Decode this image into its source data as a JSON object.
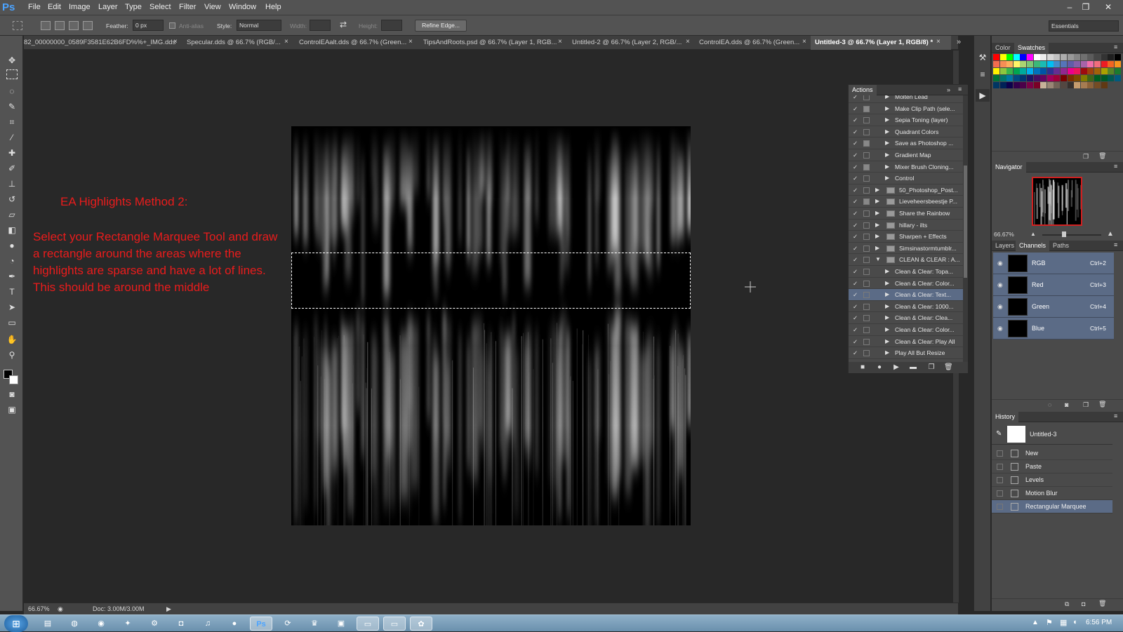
{
  "app": {
    "logo": "Ps"
  },
  "menu": [
    "File",
    "Edit",
    "Image",
    "Layer",
    "Type",
    "Select",
    "Filter",
    "View",
    "Window",
    "Help"
  ],
  "window_controls": {
    "minimize": "–",
    "restore": "❐",
    "close": "✕"
  },
  "options": {
    "feather_label": "Feather:",
    "feather_value": "0 px",
    "antialias_label": "Anti-alias",
    "style_label": "Style:",
    "style_value": "Normal",
    "width_label": "Width:",
    "height_label": "Height:",
    "refine_edge": "Refine Edge...",
    "workspace": "Essentials"
  },
  "tabs": [
    {
      "label": "82_00000000_0589F3581E62B6FD%%+_IMG.dds",
      "close": "×"
    },
    {
      "label": "Specular.dds @ 66.7% (RGB/...",
      "close": "×"
    },
    {
      "label": "ControlEAalt.dds @ 66.7% (Green...",
      "close": "×"
    },
    {
      "label": "TipsAndRoots.psd @ 66.7% (Layer 1, RGB...",
      "close": "×"
    },
    {
      "label": "Untitled-2 @ 66.7% (Layer 2, RGB/...",
      "close": "×"
    },
    {
      "label": "ControlEA.dds @ 66.7% (Green...",
      "close": "×"
    },
    {
      "label": "Untitled-3 @ 66.7% (Layer 1, RGB/8) *",
      "close": "×"
    }
  ],
  "tabs_overflow": "»",
  "annotation": {
    "title": "EA Highlights Method 2:",
    "body": "Select your Rectangle Marquee Tool and draw a rectangle around the areas where the highlights are sparse and have a lot of lines.  This should be around the middle"
  },
  "status": {
    "zoom": "66.67%",
    "doc": "Doc: 3.00M/3.00M",
    "arrow": "▶"
  },
  "actions_panel": {
    "title": "Actions",
    "items": [
      {
        "name": "Molten Lead",
        "level": 1,
        "box": false
      },
      {
        "name": "Make Clip Path (sele...",
        "level": 1,
        "box": true
      },
      {
        "name": "Sepia Toning (layer)",
        "level": 1,
        "box": false
      },
      {
        "name": "Quadrant Colors",
        "level": 1,
        "box": false
      },
      {
        "name": "Save as Photoshop ...",
        "level": 1,
        "box": true
      },
      {
        "name": "Gradient Map",
        "level": 1,
        "box": false
      },
      {
        "name": "Mixer Brush Cloning...",
        "level": 1,
        "box": true
      },
      {
        "name": "Control",
        "level": 1,
        "box": false
      },
      {
        "name": "50_Photoshop_Post...",
        "level": 0,
        "box": false
      },
      {
        "name": "Lieveheersbeestje P...",
        "level": 0,
        "box": true
      },
      {
        "name": "Share the Rainbow",
        "level": 0,
        "box": false
      },
      {
        "name": "hillary - ilts",
        "level": 0,
        "box": false
      },
      {
        "name": "Sharpen + Effects",
        "level": 0,
        "box": false
      },
      {
        "name": "Simsinastormtumblr...",
        "level": 0,
        "box": false
      },
      {
        "name": "CLEAN & CLEAR : A...",
        "level": 0,
        "box": false,
        "open": true
      },
      {
        "name": "Clean & Clear: Topa...",
        "level": 1,
        "box": false
      },
      {
        "name": "Clean & Clear: Color...",
        "level": 1,
        "box": false
      },
      {
        "name": "Clean & Clear: Text...",
        "level": 1,
        "box": false,
        "selected": true
      },
      {
        "name": "Clean & Clear: 1000...",
        "level": 1,
        "box": false
      },
      {
        "name": "Clean & Clear: Clea...",
        "level": 1,
        "box": false
      },
      {
        "name": "Clean & Clear: Color...",
        "level": 1,
        "box": false
      },
      {
        "name": "Clean & Clear: Play All",
        "level": 1,
        "box": false
      },
      {
        "name": "Play All But Resize",
        "level": 1,
        "box": false
      }
    ]
  },
  "color_panel": {
    "tabs": [
      "Color",
      "Swatches"
    ],
    "active": "Swatches"
  },
  "swatch_colors": [
    "#ff0000",
    "#ffff00",
    "#00ff00",
    "#00ffff",
    "#0000ff",
    "#ff00ff",
    "#ffffff",
    "#ebebeb",
    "#d6d6d6",
    "#c2c2c2",
    "#adadad",
    "#999999",
    "#858585",
    "#707070",
    "#5c5c5c",
    "#474747",
    "#333333",
    "#1f1f1f",
    "#000000",
    "#f26c4f",
    "#f68e55",
    "#fbaf5c",
    "#fff467",
    "#acd372",
    "#7cc576",
    "#3bb878",
    "#1abbb4",
    "#00bff3",
    "#438cca",
    "#5574b9",
    "#605ca8",
    "#855fa8",
    "#a763a8",
    "#f06ea9",
    "#f26d7d",
    "#ed1c24",
    "#f26522",
    "#f7941d",
    "#fff200",
    "#8dc63f",
    "#39b54a",
    "#00a651",
    "#00a99d",
    "#00aeef",
    "#0072bc",
    "#0054a6",
    "#2e3192",
    "#662d91",
    "#92278f",
    "#ec008c",
    "#ed145b",
    "#9e0b0f",
    "#a0410d",
    "#a36209",
    "#aba000",
    "#598527",
    "#1a7b30",
    "#007236",
    "#00746b",
    "#0076a3",
    "#004b80",
    "#003471",
    "#1b1464",
    "#440e62",
    "#630460",
    "#9e005d",
    "#9e0039",
    "#790000",
    "#7b2e00",
    "#7d4900",
    "#827b00",
    "#406618",
    "#005e20",
    "#005826",
    "#005952",
    "#005b7f",
    "#003663",
    "#002157",
    "#0d004c",
    "#32004b",
    "#4b0049",
    "#7b0046",
    "#7a0026",
    "#c7b299",
    "#998675",
    "#736357",
    "#534741",
    "#37302d",
    "#c69c6d",
    "#a67c52",
    "#8c6239",
    "#754c24",
    "#603913"
  ],
  "navigator": {
    "title": "Navigator",
    "zoom": "66.67%"
  },
  "layers_panel": {
    "tabs": [
      "Layers",
      "Channels",
      "Paths"
    ],
    "active": "Channels"
  },
  "channels": [
    {
      "name": "RGB",
      "shortcut": "Ctrl+2"
    },
    {
      "name": "Red",
      "shortcut": "Ctrl+3"
    },
    {
      "name": "Green",
      "shortcut": "Ctrl+4"
    },
    {
      "name": "Blue",
      "shortcut": "Ctrl+5"
    }
  ],
  "history": {
    "title": "History",
    "snapshot": "Untitled-3",
    "items": [
      "New",
      "Paste",
      "Levels",
      "Motion Blur",
      "Rectangular Marquee"
    ]
  },
  "taskbar": {
    "clock": "6:56 PM"
  }
}
